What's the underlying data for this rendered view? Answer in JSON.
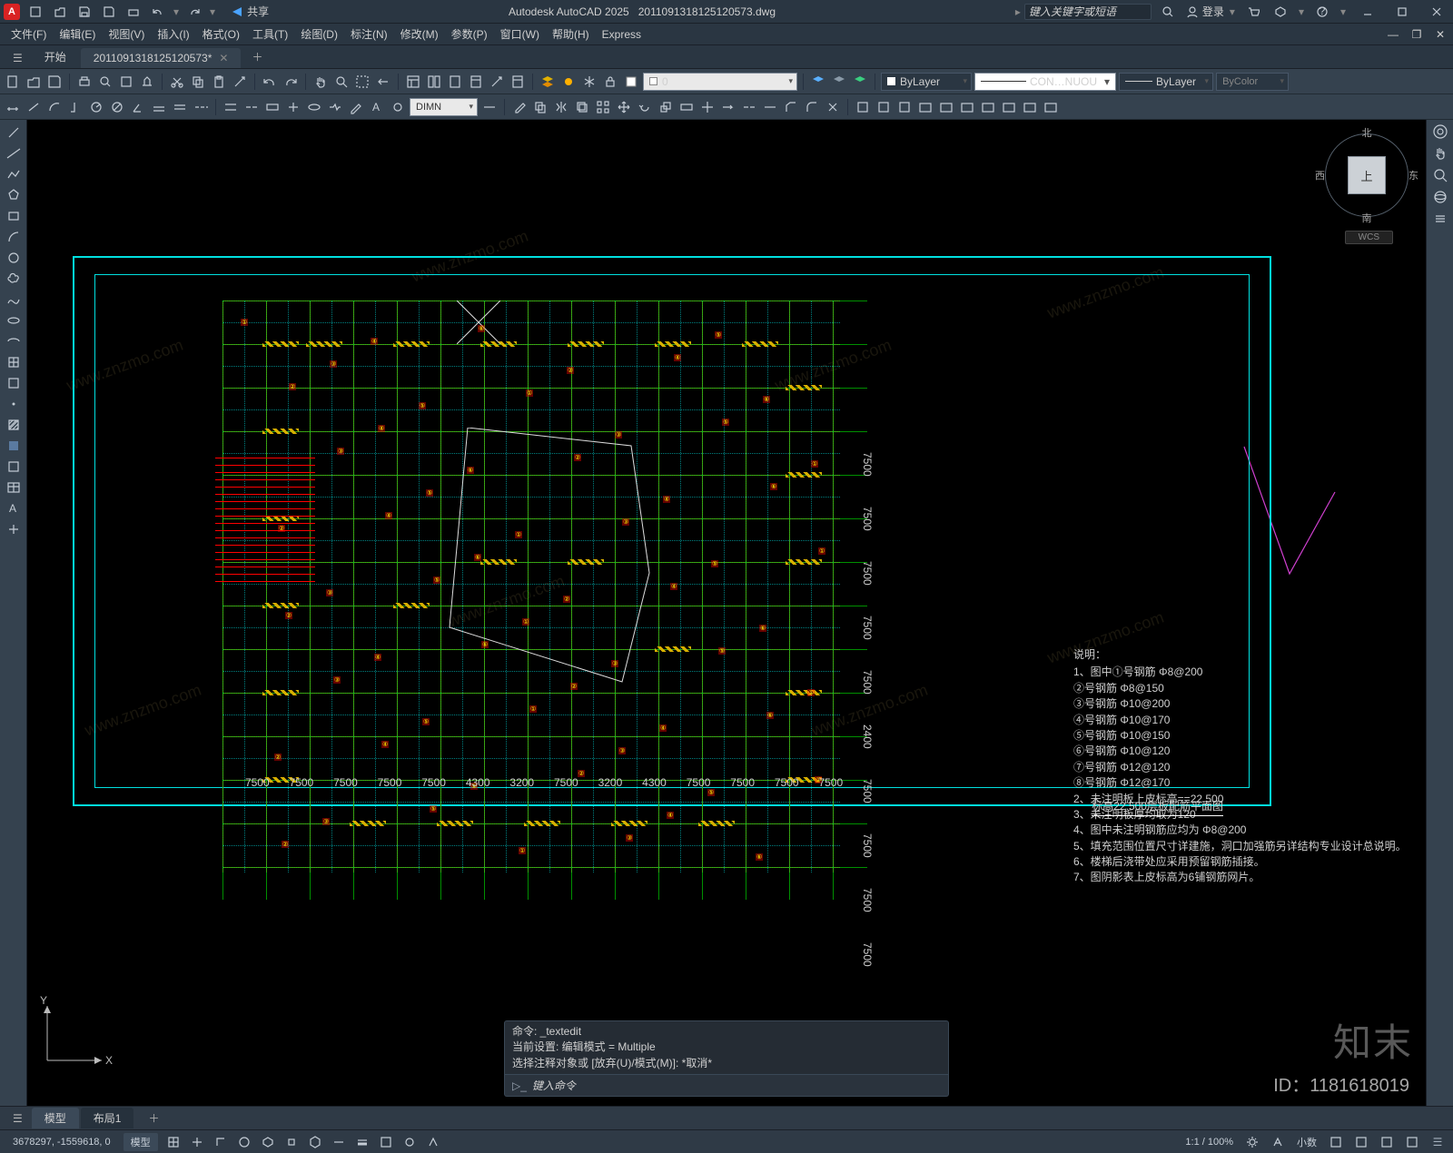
{
  "titlebar": {
    "app": "Autodesk AutoCAD 2025",
    "file": "2011091318125120573.dwg",
    "share": "共享",
    "search_placeholder": "键入关键字或短语",
    "login": "登录"
  },
  "menubar": {
    "items": [
      "文件(F)",
      "编辑(E)",
      "视图(V)",
      "插入(I)",
      "格式(O)",
      "工具(T)",
      "绘图(D)",
      "标注(N)",
      "修改(M)",
      "参数(P)",
      "窗口(W)",
      "帮助(H)",
      "Express"
    ]
  },
  "ribtabs": {
    "start": "开始",
    "doc": "2011091318125120573*"
  },
  "toolbars": {
    "layer_value": "0",
    "dim_style": "DIMN",
    "bylayer1": "ByLayer",
    "linetype": "CON…NUOU",
    "bylayer2": "ByLayer",
    "bycolor": "ByColor"
  },
  "viewcube": {
    "top": "上",
    "n": "北",
    "e": "东",
    "s": "南",
    "w": "西",
    "wcs": "WCS"
  },
  "ucs": {
    "x": "X",
    "y": "Y"
  },
  "drawing": {
    "title": "标高22.500层板配筋平面图",
    "notes_head": "说明：",
    "notes": [
      "1、图中①号钢筋 Φ8@200",
      "     ②号钢筋 Φ8@150",
      "     ③号钢筋 Φ10@200",
      "     ④号钢筋 Φ10@170",
      "     ⑤号钢筋 Φ10@150",
      "     ⑥号钢筋 Φ10@120",
      "     ⑦号钢筋 Φ12@120",
      "     ⑧号钢筋 Φ12@170",
      "2、未注明板上皮标高==22.500",
      "3、未注明板厚均取为120",
      "4、图中未注明钢筋应均为 Φ8@200",
      "5、填充范围位置尺寸详建施，洞口加强筋另详结构专业设计总说明。",
      "6、楼梯后浇带处应采用预留钢筋插接。",
      "7、图阴影表上皮标高为6铺钢筋网片。"
    ],
    "hdims": [
      "7500",
      "7500",
      "7500",
      "7500",
      "7500",
      "4300",
      "3200",
      "7500",
      "3200",
      "4300",
      "7500",
      "7500",
      "7500",
      "7500"
    ],
    "vdims": [
      "7500",
      "7500",
      "7500",
      "7500",
      "2400",
      "7500",
      "7500",
      "7500",
      "7500",
      "7500"
    ]
  },
  "command": {
    "hist1": "命令: _textedit",
    "hist2": "当前设置: 编辑模式 = Multiple",
    "hist3": "选择注释对象或 [放弃(U)/模式(M)]: *取消*",
    "prompt": "键入命令"
  },
  "modeltabs": {
    "model": "模型",
    "layout1": "布局1"
  },
  "statusbar": {
    "coords": "3678297, -1559618, 0",
    "model_btn": "模型",
    "scale": "1:1 / 100%",
    "decimal": "小数"
  },
  "watermark": {
    "brand": "知末",
    "id": "ID：1181618019",
    "diag": "www.znzmo.com"
  }
}
